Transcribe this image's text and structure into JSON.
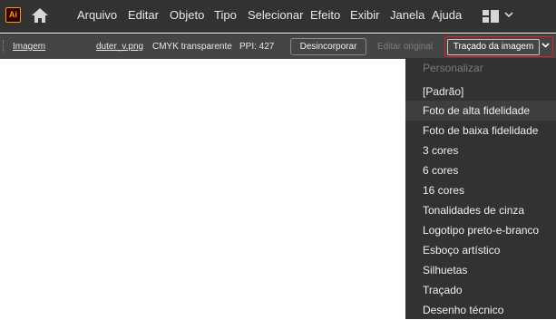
{
  "app": {
    "logo_text": "Ai"
  },
  "menu": {
    "items": [
      "Arquivo",
      "Editar",
      "Objeto",
      "Tipo",
      "Selecionar",
      "Efeito",
      "Exibir",
      "Janela",
      "Ajuda"
    ]
  },
  "control_bar": {
    "object_type": "Imagem",
    "file_name": "duter_v.png",
    "color_mode": "CMYK transparente",
    "ppi": "PPI: 427",
    "embed_button": "Desincorporar",
    "edit_original": "Editar original",
    "trace_button": "Traçado da imagem"
  },
  "trace_menu": {
    "header": "Personalizar",
    "items": [
      "[Padrão]",
      "Foto de alta fidelidade",
      "Foto de baixa fidelidade",
      "3 cores",
      "6 cores",
      "16 cores",
      "Tonalidades de cinza",
      "Logotipo preto-e-branco",
      "Esboço artístico",
      "Silhuetas",
      "Traçado",
      "Desenho técnico"
    ]
  },
  "colors": {
    "accent_highlight": "#e02020",
    "logo": "#ff9a00"
  }
}
